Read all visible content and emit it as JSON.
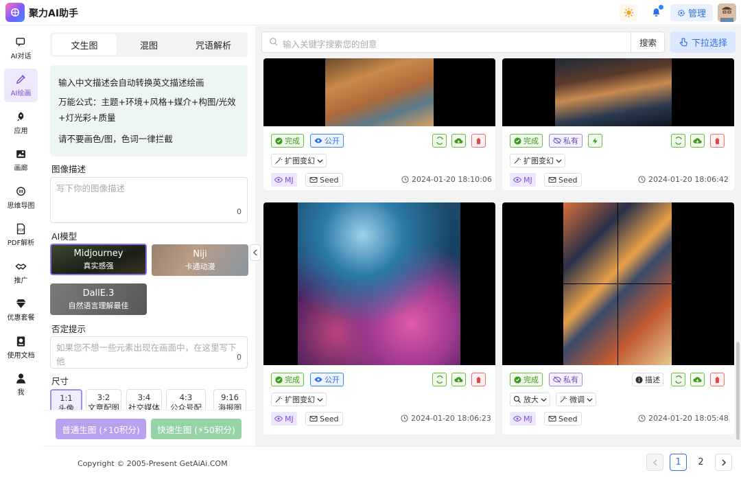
{
  "app": {
    "title": "聚力AI助手",
    "manage_label": "管理"
  },
  "sidebar": {
    "items": [
      {
        "label": "AI对话",
        "icon": "chat-icon"
      },
      {
        "label": "AI绘画",
        "icon": "brush-icon"
      },
      {
        "label": "应用",
        "icon": "rocket-icon"
      },
      {
        "label": "画廊",
        "icon": "image-icon"
      },
      {
        "label": "思维导图",
        "icon": "mindmap-icon"
      },
      {
        "label": "PDF解析",
        "icon": "pdf-icon"
      },
      {
        "label": "推广",
        "icon": "handshake-icon"
      },
      {
        "label": "优惠套餐",
        "icon": "diamond-icon"
      },
      {
        "label": "使用文档",
        "icon": "doc-icon"
      },
      {
        "label": "我",
        "icon": "user-icon"
      }
    ]
  },
  "left": {
    "tabs": [
      "文生图",
      "混图",
      "咒语解析"
    ],
    "tip": [
      "输入中文描述会自动转换英文描述绘画",
      "万能公式：主题+环境+风格+媒介+构图/光效",
      "+灯光彩+质量",
      "请不要画色/图，色词一律拦截"
    ],
    "desc_label": "图像描述",
    "desc_placeholder": "写下你的图像描述",
    "desc_count": "0",
    "model_label": "AI模型",
    "models": [
      {
        "name": "Midjourney",
        "desc": "真实感强"
      },
      {
        "name": "Niji",
        "desc": "卡通动漫"
      },
      {
        "name": "DallE.3",
        "desc": "自然语言理解最佳"
      }
    ],
    "neg_label": "否定提示",
    "neg_placeholder": "如果您不想一些元素出现在画面中，在这里写下他",
    "neg_count": "0",
    "size_label": "尺寸",
    "sizes": [
      {
        "ratio": "1:1",
        "use": "头像"
      },
      {
        "ratio": "3:2",
        "use": "文章配图"
      },
      {
        "ratio": "3:4",
        "use": "社交媒体"
      },
      {
        "ratio": "4:3",
        "use": "公众号配图"
      },
      {
        "ratio": "9:16",
        "use": "海报图"
      }
    ],
    "normal_btn": "普通生图 (⚡10积分)",
    "fast_btn": "快速生图 (⚡50积分)"
  },
  "search": {
    "placeholder": "输入关键字搜索您的创意",
    "button": "搜索",
    "dropdown": "下拉选择"
  },
  "cards": [
    {
      "status": "完成",
      "visibility": "公开",
      "extend": "扩图变幻",
      "mj": "MJ",
      "seed": "Seed",
      "time": "2024-01-20 18:10:06"
    },
    {
      "status": "完成",
      "visibility": "私有",
      "extend": "扩图变幻",
      "mj": "MJ",
      "seed": "Seed",
      "time": "2024-01-20 18:06:42"
    },
    {
      "status": "完成",
      "visibility": "公开",
      "extend": "扩图变幻",
      "mj": "MJ",
      "seed": "Seed",
      "time": "2024-01-20 18:06:23"
    },
    {
      "status": "完成",
      "visibility": "私有",
      "describe": "描述",
      "zoom": "放大",
      "fine": "微调",
      "mj": "MJ",
      "seed": "Seed",
      "time": "2024-01-20 18:05:48"
    }
  ],
  "footer": {
    "copyright": "Copyright © 2005-Present GetAiAi.COM",
    "pages": [
      "1",
      "2"
    ]
  }
}
